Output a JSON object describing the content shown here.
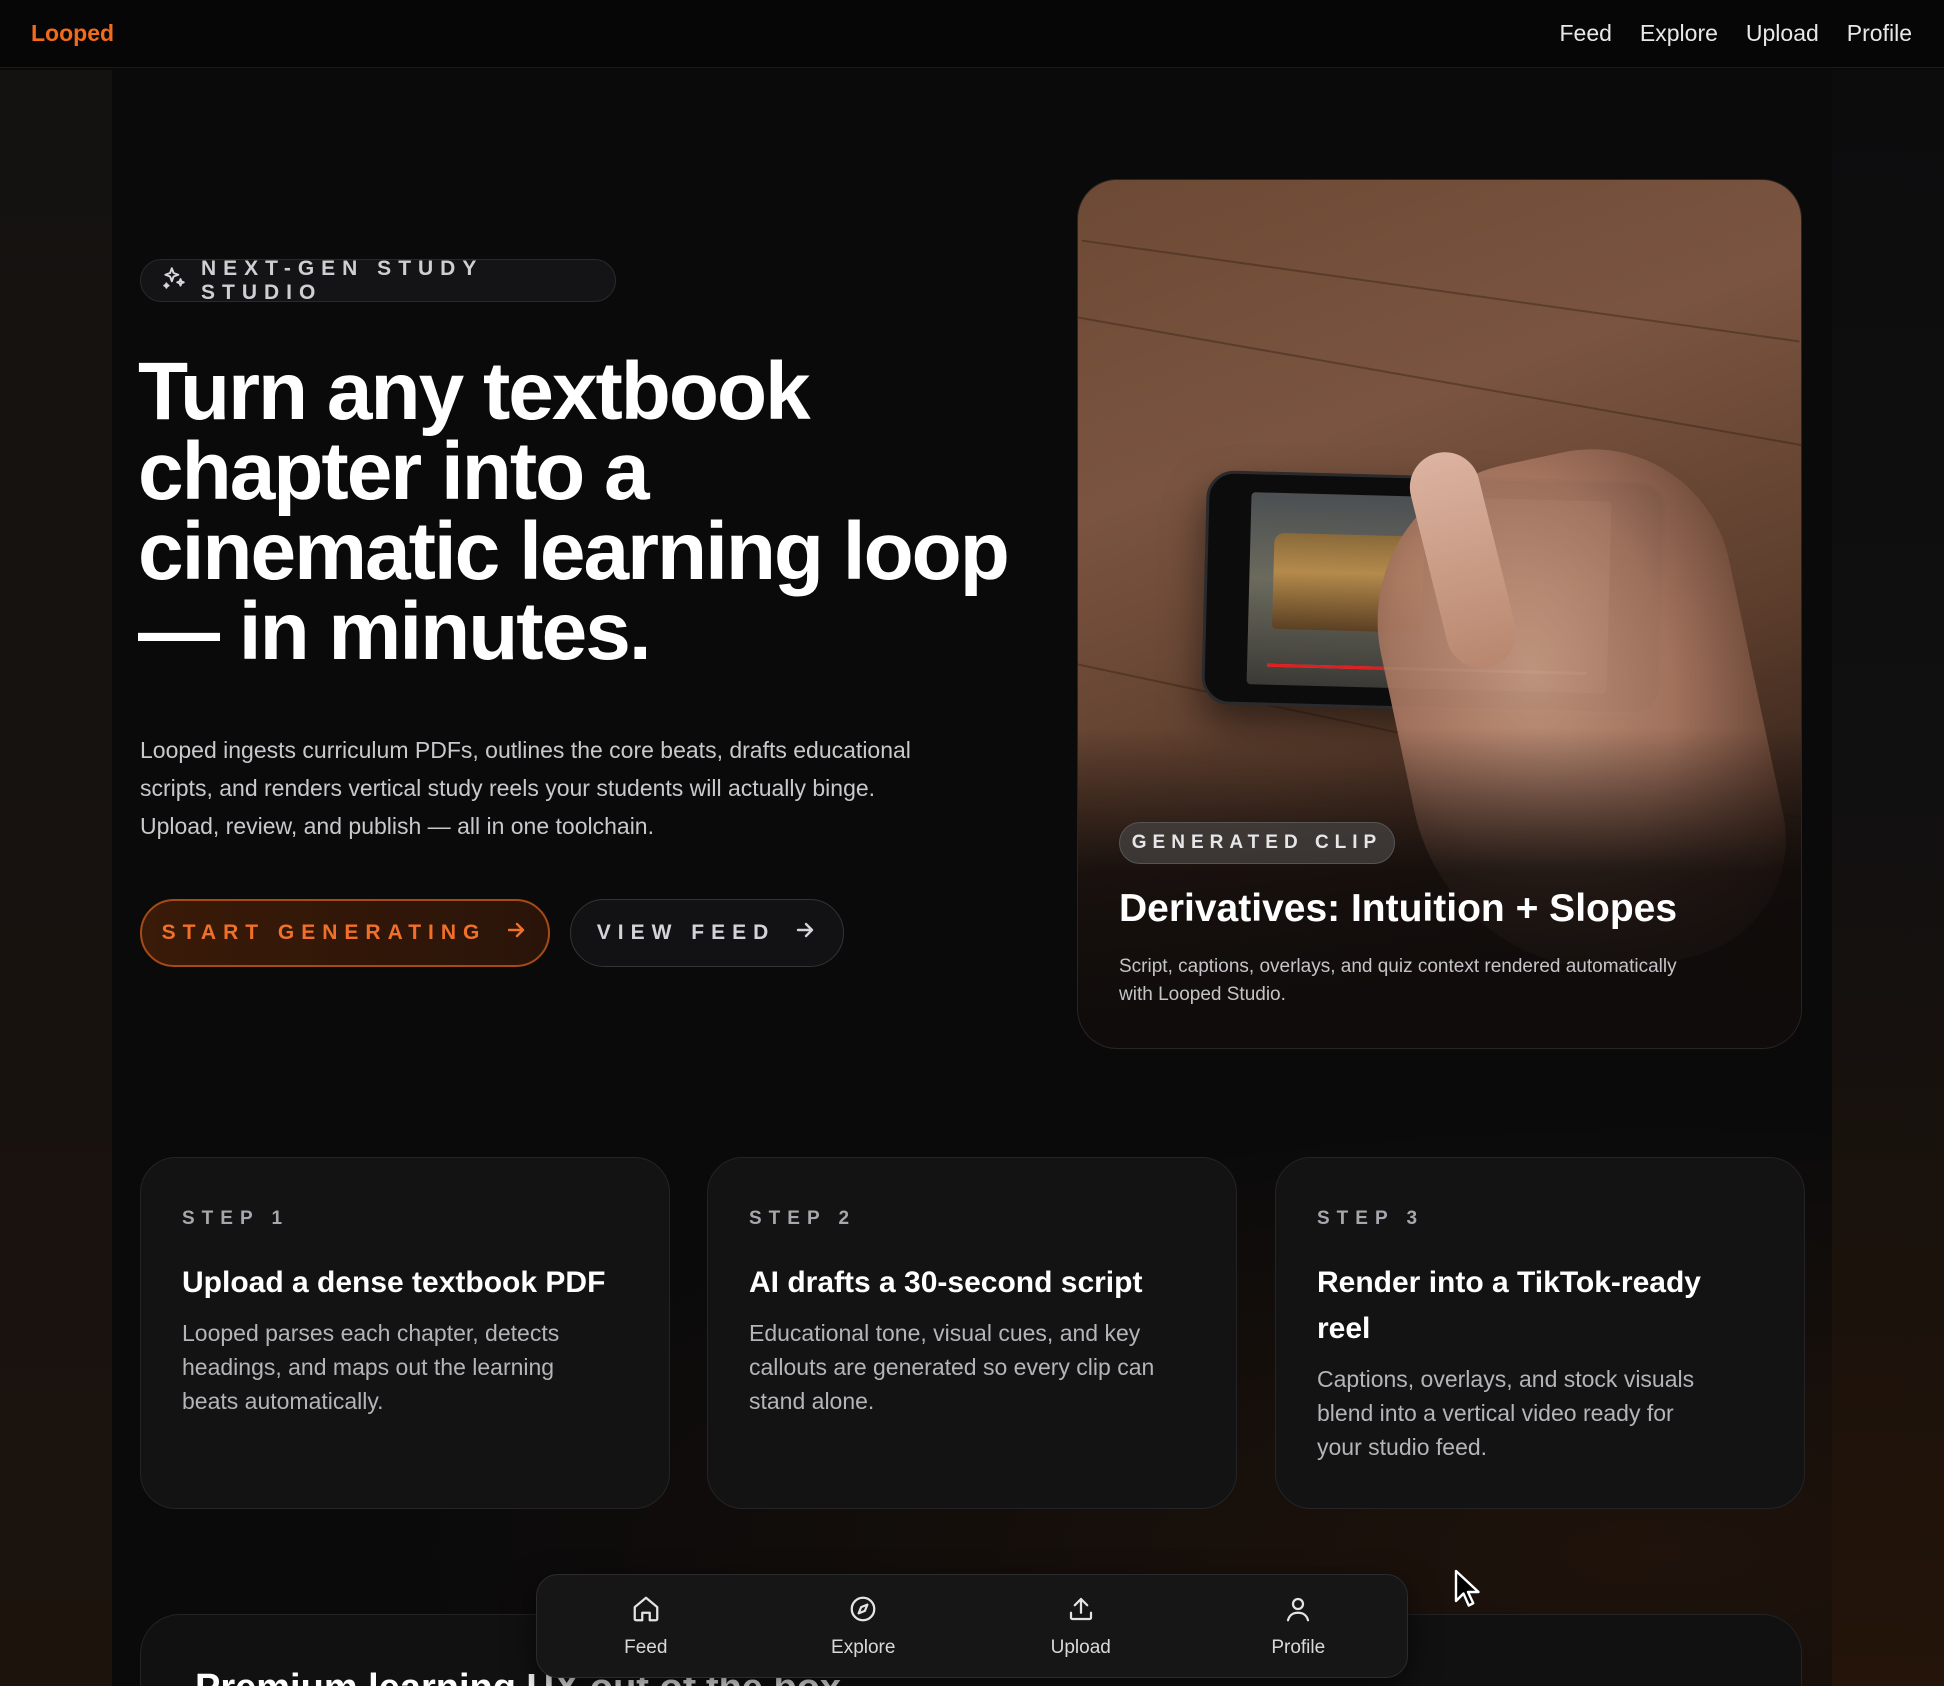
{
  "nav": {
    "brand": "Looped",
    "links": [
      "Feed",
      "Explore",
      "Upload",
      "Profile"
    ]
  },
  "hero": {
    "badge": "NEXT-GEN STUDY STUDIO",
    "headline_lines": [
      "Turn any textbook",
      "chapter into a",
      "cinematic learning loop",
      "— in minutes."
    ],
    "lede_lines": [
      "Looped ingests curriculum PDFs, outlines the core beats, drafts educational",
      "scripts, and renders vertical study reels your students will actually binge.",
      "Upload, review, and publish — all in one toolchain."
    ],
    "primary_cta": "START GENERATING",
    "secondary_cta": "VIEW FEED"
  },
  "clip_card": {
    "pill": "GENERATED CLIP",
    "title": "Derivatives: Intuition + Slopes",
    "description_lines": [
      "Script, captions, overlays, and quiz context rendered automatically",
      "with Looped Studio."
    ]
  },
  "steps": [
    {
      "kicker": "STEP 1",
      "title": "Upload a dense textbook PDF",
      "body_lines": [
        "Looped parses each chapter, detects",
        "headings, and maps out the learning",
        "beats automatically."
      ]
    },
    {
      "kicker": "STEP 2",
      "title": "AI drafts a 30-second script",
      "body_lines": [
        "Educational tone, visual cues, and key",
        "callouts are generated so every clip can",
        "stand alone."
      ]
    },
    {
      "kicker": "STEP 3",
      "title_lines": [
        "Render into a TikTok-ready",
        "reel"
      ],
      "body_lines": [
        "Captions, overlays, and stock visuals",
        "blend into a vertical video ready for",
        "your studio feed."
      ]
    }
  ],
  "next_section": {
    "title_partial": "Premium learning UX out of the box"
  },
  "tabbar": {
    "tabs": [
      {
        "label": "Feed",
        "icon": "home-icon"
      },
      {
        "label": "Explore",
        "icon": "compass-icon"
      },
      {
        "label": "Upload",
        "icon": "upload-icon"
      },
      {
        "label": "Profile",
        "icon": "user-icon"
      }
    ]
  },
  "colors": {
    "accent": "#f26a1b",
    "background": "#0a0a0b",
    "card": "#131314"
  }
}
